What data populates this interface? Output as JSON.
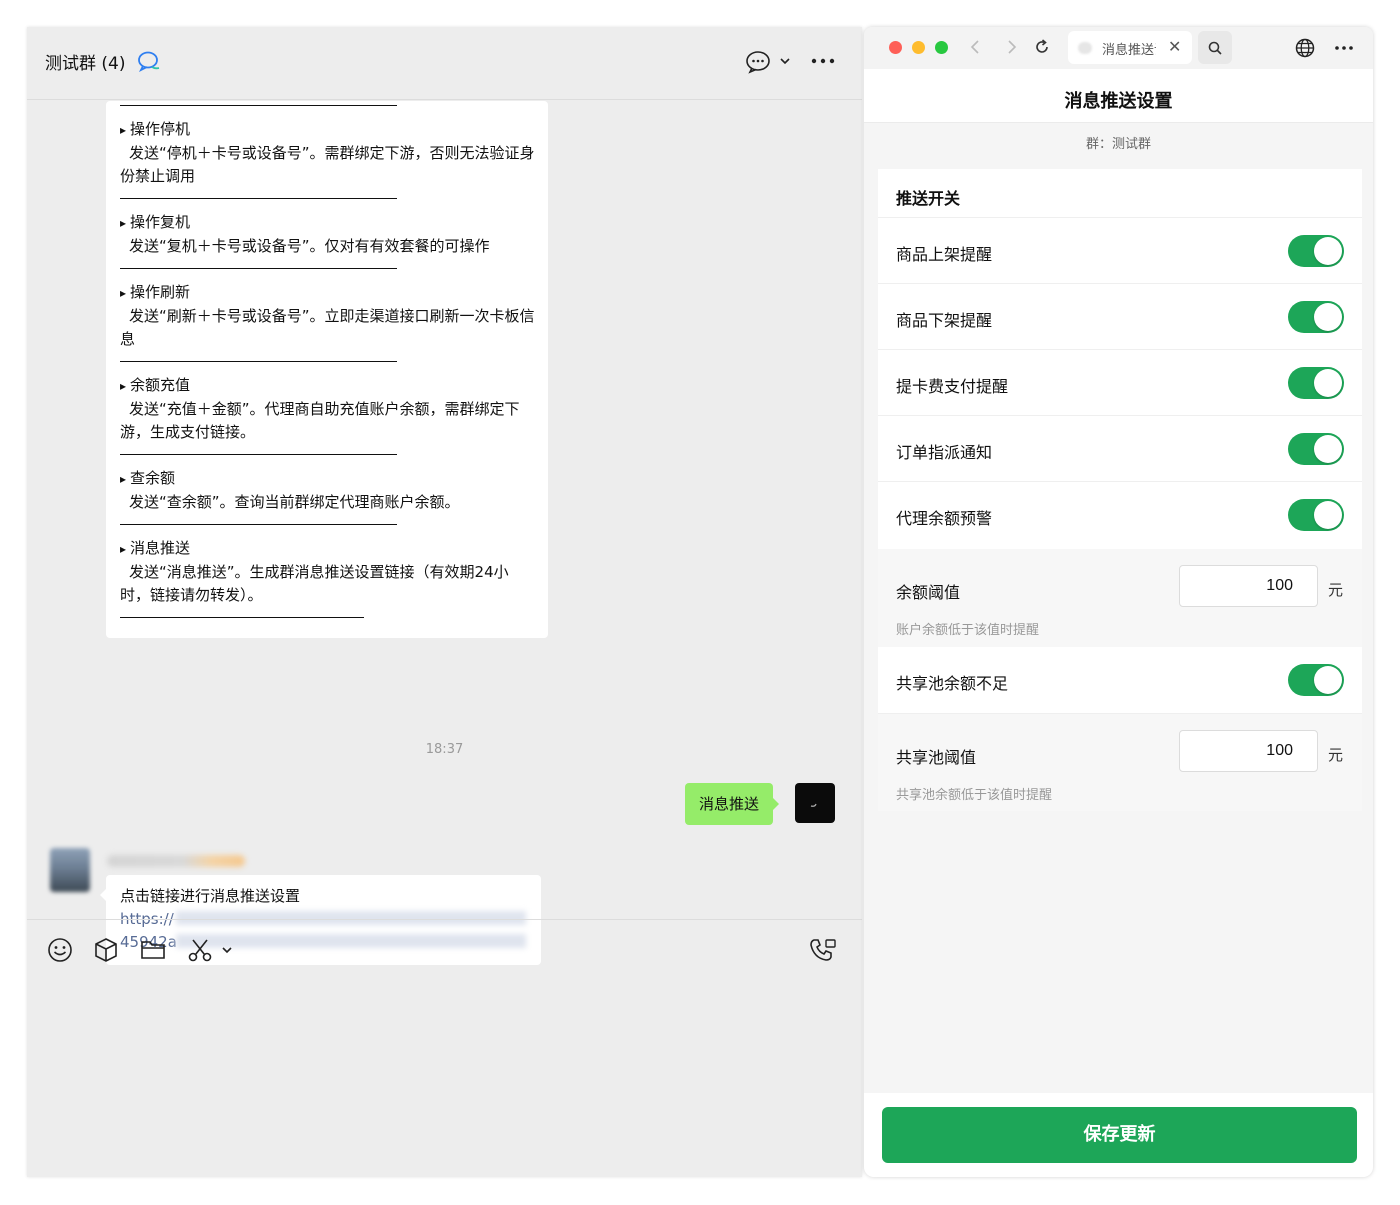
{
  "chat": {
    "title": "测试群 (4)",
    "sections": [
      {
        "heading": "操作停机",
        "desc": "发送“停机＋卡号或设备号”。需群绑定下游，否则无法验证身份禁止调用"
      },
      {
        "heading": "操作复机",
        "desc": "发送“复机＋卡号或设备号”。仅对有有效套餐的可操作"
      },
      {
        "heading": "操作刷新",
        "desc": "发送“刷新＋卡号或设备号”。立即走渠道接口刷新一次卡板信息"
      },
      {
        "heading": "余额充值",
        "desc": "发送“充值＋金额”。代理商自助充值账户余额，需群绑定下游，生成支付链接。"
      },
      {
        "heading": "查余额",
        "desc": "发送“查余额”。查询当前群绑定代理商账户余额。"
      },
      {
        "heading": "消息推送",
        "desc": "发送“消息推送”。生成群消息推送设置链接（有效期24小时，链接请勿转发）。"
      }
    ],
    "timestamp": "18:37",
    "my_message": "消息推送",
    "reply_text": "点击链接进行消息推送设置",
    "link_line1": "https://",
    "link_line2": "45942a"
  },
  "browser": {
    "tab_title": "消息推送设置",
    "page_title": "消息推送设置",
    "group_label": "群：测试群",
    "switch_section_title": "推送开关",
    "switches": [
      {
        "label": "商品上架提醒",
        "on": true
      },
      {
        "label": "商品下架提醒",
        "on": true
      },
      {
        "label": "提卡费支付提醒",
        "on": true
      },
      {
        "label": "订单指派通知",
        "on": true
      },
      {
        "label": "代理余额预警",
        "on": true
      }
    ],
    "balance_threshold": {
      "label": "余额阈值",
      "value": "100",
      "unit": "元",
      "hint": "账户余额低于该值时提醒"
    },
    "pool_switch": {
      "label": "共享池余额不足",
      "on": true
    },
    "pool_threshold": {
      "label": "共享池阈值",
      "value": "100",
      "unit": "元",
      "hint": "共享池余额低于该值时提醒"
    },
    "save_label": "保存更新"
  },
  "colors": {
    "accent_green": "#1da658",
    "bubble_green": "#95ec69",
    "link_blue": "#576b95"
  },
  "icons": [
    "chat-bubble-icon",
    "chevron-down-icon",
    "more-icon",
    "emoji-icon",
    "cube-icon",
    "folder-icon",
    "scissors-icon",
    "phone-icon",
    "back-icon",
    "forward-icon",
    "reload-icon",
    "search-icon",
    "globe-icon",
    "close-icon"
  ]
}
